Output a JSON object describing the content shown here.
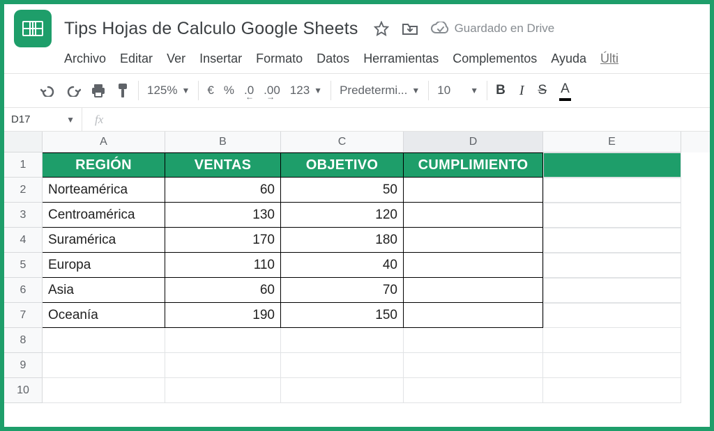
{
  "header": {
    "doc_title": "Tips Hojas de Calculo Google Sheets",
    "drive_status": "Guardado en Drive"
  },
  "menu": [
    "Archivo",
    "Editar",
    "Ver",
    "Insertar",
    "Formato",
    "Datos",
    "Herramientas",
    "Complementos",
    "Ayuda"
  ],
  "menu_last": "Últi",
  "toolbar": {
    "zoom": "125%",
    "currency": "€",
    "percent": "%",
    "dec_neg": ".0",
    "dec_pos": ".00",
    "num_format": "123",
    "font": "Predetermi...",
    "font_size": "10",
    "bold": "B",
    "italic": "I",
    "strike": "S",
    "text_color": "A"
  },
  "name_box": "D17",
  "columns": [
    "A",
    "B",
    "C",
    "D",
    "E"
  ],
  "row_numbers": [
    "1",
    "2",
    "3",
    "4",
    "5",
    "6",
    "7",
    "8",
    "9",
    "10"
  ],
  "table_header": [
    "REGIÓN",
    "VENTAS",
    "OBJETIVO",
    "CUMPLIMIENTO"
  ],
  "table_rows": [
    {
      "region": "Norteamérica",
      "ventas": "60",
      "objetivo": "50",
      "cumplimiento": ""
    },
    {
      "region": "Centroamérica",
      "ventas": "130",
      "objetivo": "120",
      "cumplimiento": ""
    },
    {
      "region": "Suramérica",
      "ventas": "170",
      "objetivo": "180",
      "cumplimiento": ""
    },
    {
      "region": "Europa",
      "ventas": "110",
      "objetivo": "40",
      "cumplimiento": ""
    },
    {
      "region": "Asia",
      "ventas": "60",
      "objetivo": "70",
      "cumplimiento": ""
    },
    {
      "region": "Oceanía",
      "ventas": "190",
      "objetivo": "150",
      "cumplimiento": ""
    }
  ],
  "active_column": "D"
}
